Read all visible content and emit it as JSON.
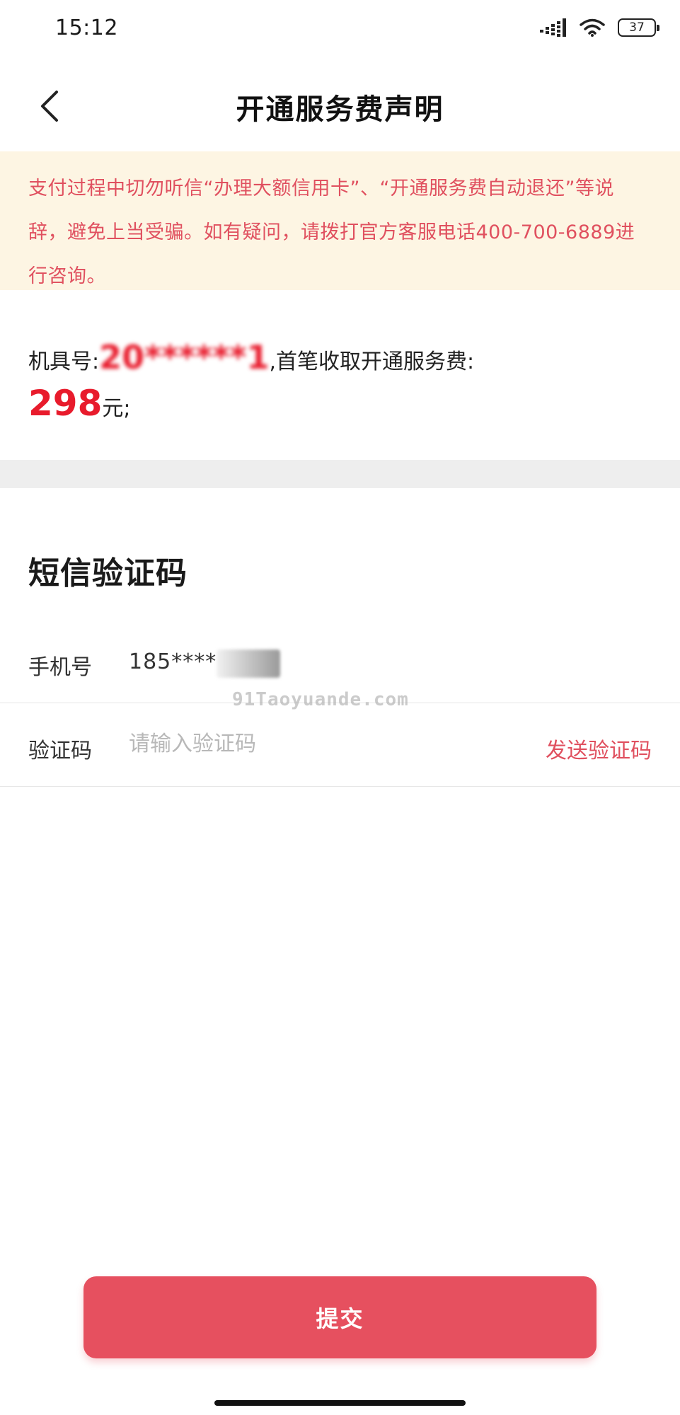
{
  "status_bar": {
    "time": "15:12",
    "battery": "37"
  },
  "header": {
    "title": "开通服务费声明"
  },
  "warning": {
    "text": "支付过程中切勿听信“办理大额信用卡”、“开通服务费自动退还”等说辞，避免上当受骗。如有疑问，请拨打官方客服电话400-700-6889进行咨询。"
  },
  "fee": {
    "device_label": "机具号:",
    "device_number": "20******1",
    "fee_label": ",首笔收取开通服务费:",
    "amount": "298",
    "unit": "元;"
  },
  "sms": {
    "title": "短信验证码",
    "phone_label": "手机号",
    "phone_value": "185****",
    "code_label": "验证码",
    "code_placeholder": "请输入验证码",
    "send_label": "发送验证码"
  },
  "watermark": "91Taoyuande.com",
  "submit": {
    "label": "提交"
  }
}
